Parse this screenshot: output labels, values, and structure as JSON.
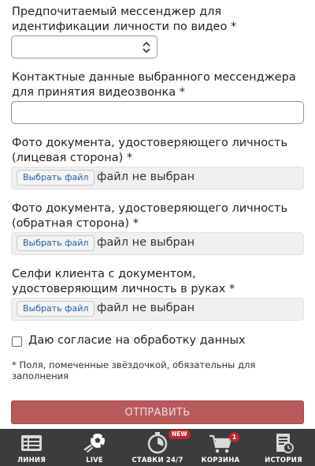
{
  "form": {
    "messenger_label": "Предпочитаемый мессенджер для идентификации личности по видео *",
    "messenger_select_value": "",
    "contact_label": "Контактные данные выбранного мессенджера для принятия видеозвонка *",
    "contact_value": "",
    "doc_front_label": "Фото документа, удостоверяющего личность (лицевая сторона) *",
    "doc_back_label": "Фото документа, удостоверяющего личность (обратная сторона) *",
    "selfie_label": "Селфи клиента с документом, удостоверяющим личность в руках *",
    "choose_file_label": "Выбрать файл",
    "no_file_label": "файл не выбран",
    "consent_label": "Даю согласие на обработку данных",
    "consent_checked": false,
    "required_note": "* Поля, помеченные звёздочкой, обязательны для заполнения",
    "submit_label": "ОТПРАВИТЬ"
  },
  "tabbar": {
    "items": [
      {
        "label": "ЛИНИЯ",
        "icon": "list-icon"
      },
      {
        "label": "LIVE",
        "icon": "soccer-ball-icon"
      },
      {
        "label": "СТАВКИ 24/7",
        "icon": "stopwatch-icon",
        "badge": "NEW"
      },
      {
        "label": "КОРЗИНА",
        "icon": "cart-icon",
        "badge": "1"
      },
      {
        "label": "ИСТОРИЯ",
        "icon": "history-icon"
      }
    ]
  },
  "colors": {
    "submit_bg": "#b9595b",
    "tabbar_bg": "#3c3c3c",
    "badge": "#c1272d",
    "file_button_text": "#1f5fa8"
  }
}
